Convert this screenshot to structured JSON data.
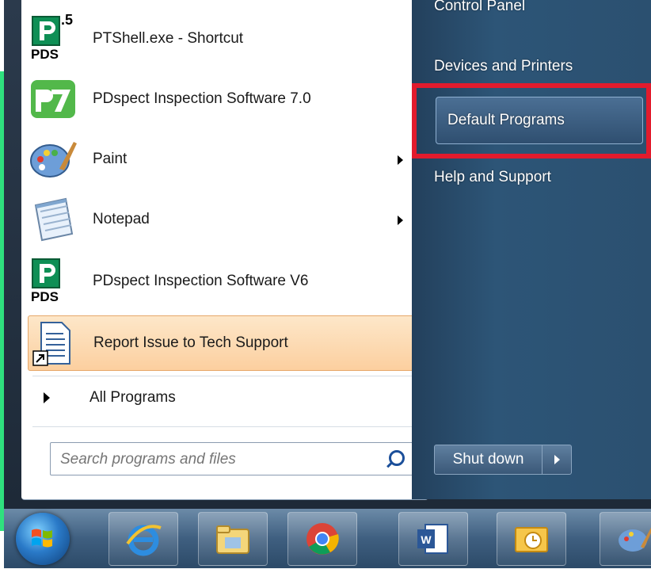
{
  "programs": [
    {
      "label": "PTShell.exe - Shortcut",
      "icon": "pds-5-icon",
      "badge_top": ".5",
      "badge_bottom": "PDS",
      "arrow": false,
      "selected": false
    },
    {
      "label": "PDspect Inspection Software 7.0",
      "icon": "pdspect-7-icon",
      "badge_top": "7",
      "badge_bottom": "",
      "arrow": false,
      "selected": false
    },
    {
      "label": "Paint",
      "icon": "paint-palette-icon",
      "badge_top": "",
      "badge_bottom": "",
      "arrow": true,
      "selected": false
    },
    {
      "label": "Notepad",
      "icon": "notepad-icon",
      "badge_top": "",
      "badge_bottom": "",
      "arrow": true,
      "selected": false
    },
    {
      "label": "PDspect Inspection Software V6",
      "icon": "pds-icon",
      "badge_top": "",
      "badge_bottom": "PDS",
      "arrow": false,
      "selected": false
    },
    {
      "label": "Report Issue to Tech Support",
      "icon": "document-shortcut-icon",
      "badge_top": "",
      "badge_bottom": "",
      "arrow": false,
      "selected": true
    }
  ],
  "all_programs": "All Programs",
  "search": {
    "placeholder": "Search programs and files"
  },
  "right": {
    "top_partial": "Control Panel",
    "items": [
      "Devices and Printers",
      "Default Programs",
      "Help and Support"
    ],
    "highlighted": "Default Programs"
  },
  "shutdown": {
    "label": "Shut down"
  },
  "taskbar": [
    "internet-explorer-icon",
    "file-explorer-icon",
    "chrome-icon",
    "word-icon",
    "outlook-icon",
    "paint-icon"
  ],
  "colors": {
    "highlight_box": "#e21b2d",
    "selected_item": "#fccf9f",
    "backdrop_green": "#2fe07e"
  }
}
